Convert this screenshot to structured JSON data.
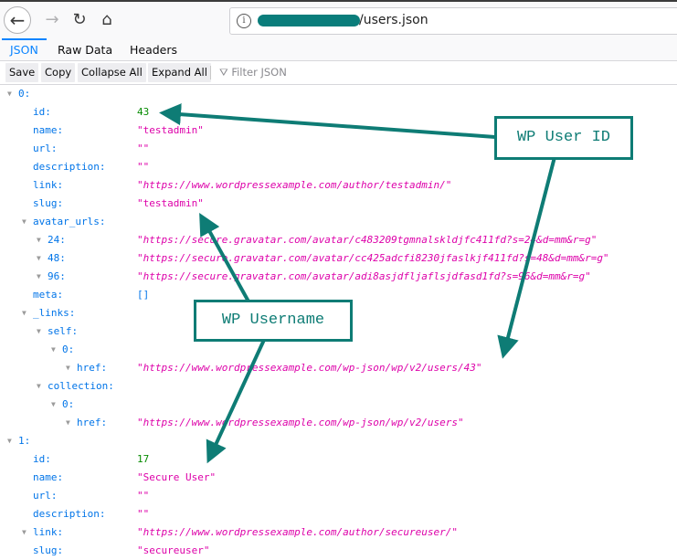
{
  "browser": {
    "url_suffix": "/users.json",
    "icons": {
      "back": "arrow-left-icon",
      "forward": "arrow-right-icon",
      "reload": "reload-icon",
      "home": "home-icon",
      "info": "info-icon"
    }
  },
  "viewer_tabs": [
    {
      "label": "JSON",
      "active": true
    },
    {
      "label": "Raw Data",
      "active": false
    },
    {
      "label": "Headers",
      "active": false
    }
  ],
  "toolbar": {
    "save": "Save",
    "copy": "Copy",
    "collapse_all": "Collapse All",
    "expand_all": "Expand All",
    "filter_placeholder": "Filter JSON"
  },
  "tree": {
    "u0": {
      "label": "0:",
      "id_key": "id:",
      "id": "43",
      "name_key": "name:",
      "name": "\"testadmin\"",
      "url_key": "url:",
      "url": "\"\"",
      "desc_key": "description:",
      "desc": "\"\"",
      "link_key": "link:",
      "link": "\"https://www.wordpressexample.com/author/testadmin/\"",
      "slug_key": "slug:",
      "slug": "\"testadmin\"",
      "avatar_key": "avatar_urls:",
      "a24_key": "24:",
      "a24": "\"https://secure.gravatar.com/avatar/c483209tgmnalskldjfc411fd?s=24&d=mm&r=g\"",
      "a48_key": "48:",
      "a48": "\"https://secure.gravatar.com/avatar/cc425adcfi8230jfaslkjf411fd?s=48&d=mm&r=g\"",
      "a96_key": "96:",
      "a96": "\"https://secure.gravatar.com/avatar/adi8asjdfljaflsjdfasd1fd?s=96&d=mm&r=g\"",
      "meta_key": "meta:",
      "meta": "[]",
      "links_key": "_links:",
      "self_key": "self:",
      "self0_key": "0:",
      "href_key": "href:",
      "self_href": "\"https://www.wordpressexample.com/wp-json/wp/v2/users/43\"",
      "coll_key": "collection:",
      "coll0_key": "0:",
      "coll_href": "\"https://www.wordpressexample.com/wp-json/wp/v2/users\""
    },
    "u1": {
      "label": "1:",
      "id_key": "id:",
      "id": "17",
      "name_key": "name:",
      "name": "\"Secure User\"",
      "url_key": "url:",
      "url": "\"\"",
      "desc_key": "description:",
      "desc": "\"\"",
      "link_key": "link:",
      "link": "\"https://www.wordpressexample.com/author/secureuser/\"",
      "slug_key": "slug:",
      "slug": "\"secureuser\""
    }
  },
  "annotations": {
    "user_id": "WP User ID",
    "username": "WP Username",
    "color": "#0e7c75"
  }
}
